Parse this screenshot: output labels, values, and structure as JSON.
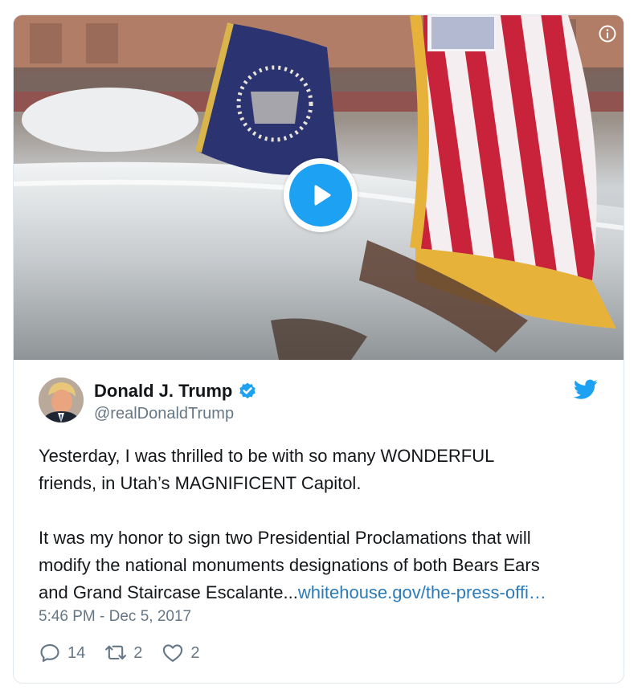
{
  "media": {
    "type": "video",
    "play_icon": "play-icon",
    "info_icon": "info-icon"
  },
  "author": {
    "display_name": "Donald J. Trump",
    "handle": "@realDonaldTrump",
    "verified": true,
    "verified_icon": "verified-badge-icon",
    "avatar_icon": "avatar"
  },
  "brand": {
    "logo_icon": "twitter-bird-icon",
    "accent_color": "#1da1f2",
    "link_color": "#2b7bb9"
  },
  "tweet": {
    "lines": [
      "Yesterday, I was thrilled to be with so many WONDERFUL",
      "friends, in Utah’s MAGNIFICENT Capitol.",
      "It was my honor to sign two Presidential Proclamations that will",
      "modify the national monuments designations of both Bears Ears",
      "and Grand Staircase Escalante..."
    ],
    "link_text": "whitehouse.gov/the-press-offi…",
    "timestamp": "5:46 PM - Dec 5, 2017"
  },
  "actions": {
    "reply": {
      "icon": "reply-icon",
      "count": "14"
    },
    "retweet": {
      "icon": "retweet-icon",
      "count": "2"
    },
    "like": {
      "icon": "heart-icon",
      "count": "2"
    }
  }
}
